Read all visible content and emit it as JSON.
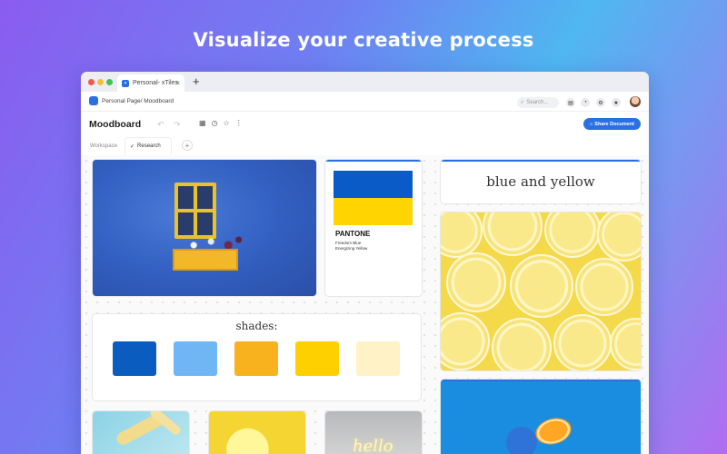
{
  "headline": "Visualize your creative process",
  "browser": {
    "tab_title": "Personal- xTiles",
    "tab_close": "×",
    "new_tab": "+"
  },
  "urlbar": {
    "breadcrumb": "Personal Page/ Moodboard",
    "search_placeholder": "Search..."
  },
  "document": {
    "title": "Moodboard",
    "share_label": "Share Document"
  },
  "subtabs": {
    "workspace": "Workspace",
    "research": "Research",
    "add": "+"
  },
  "cards": {
    "pantone": {
      "brand": "PANTONE",
      "line1": "Freedom Blue",
      "line2": "Energizing Yellow"
    },
    "title_card": "blue and yellow",
    "shades_title": "shades:",
    "shades": [
      "#0a5cbf",
      "#70b6f4",
      "#f7b21e",
      "#ffd000",
      "#fff2c6"
    ],
    "neon_text": "hello"
  },
  "colors": {
    "accent": "#2b6fe5",
    "pantone_blue": "#0a5ac8",
    "pantone_yellow": "#ffd400"
  }
}
